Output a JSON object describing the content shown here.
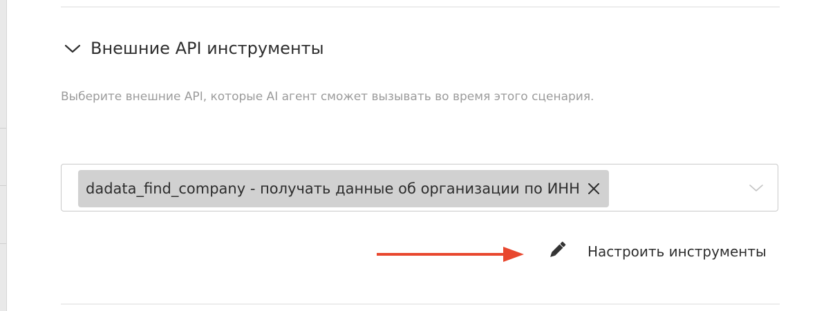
{
  "section": {
    "title": "Внешние API инструменты",
    "collapse_icon": "chevron-down-icon",
    "description": "Выберите внешние API, которые AI агент сможет вызывать во время этого сценария."
  },
  "tools_select": {
    "selected": [
      {
        "label": "dadata_find_company - получать данные об организации по ИНН",
        "remove_icon": "close-icon"
      }
    ],
    "dropdown_icon": "chevron-down-icon"
  },
  "configure": {
    "label": "Настроить инструменты",
    "icon": "pencil-icon"
  },
  "annotation": {
    "icon": "arrow-right-icon",
    "color": "#e8472e"
  },
  "colors": {
    "tag_background": "#d1d1d1",
    "border": "#c9c9c9",
    "muted_text": "#9b9b9b",
    "text": "#2e2e2e"
  }
}
